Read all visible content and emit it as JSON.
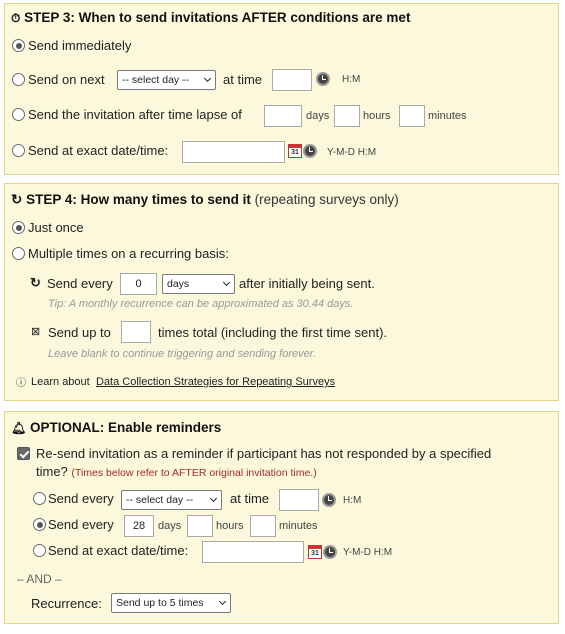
{
  "step3": {
    "title": "STEP 3: When to send invitations AFTER conditions are met",
    "send_immediately": "Send immediately",
    "send_next": "Send on next",
    "select_day": "-- select day --",
    "at_time": "at time",
    "hm": "H:M",
    "lapse": "Send the invitation after time lapse of",
    "days": "days",
    "hours": "hours",
    "minutes": "minutes",
    "exact": "Send at exact date/time:",
    "ymdhm": "Y-M-D H:M",
    "cal_num": "31"
  },
  "step4": {
    "title": "STEP 4: How many times to send it",
    "title_note": "(repeating surveys only)",
    "just_once": "Just once",
    "multiple": "Multiple times on a recurring basis:",
    "send_every": "Send every",
    "every_value": "0",
    "unit": "days",
    "after": "after initially being sent.",
    "tip1": "Tip: A monthly recurrence can be approximated as 30.44 days.",
    "send_up_to": "Send up to",
    "times_total": "times total (including the first time sent).",
    "tip2": "Leave blank to continue triggering and sending forever.",
    "learn": "Learn about",
    "link": "Data Collection Strategies for Repeating Surveys"
  },
  "reminders": {
    "title": "OPTIONAL: Enable reminders",
    "resend_line1": "Re-send invitation as a reminder if participant has not responded by a specified",
    "resend_line2": "time?",
    "resend_note": "(Times below refer to AFTER original invitation time.)",
    "send_every": "Send every",
    "select_day": "-- select day --",
    "at_time": "at time",
    "hm": "H:M",
    "days_value": "28",
    "days": "days",
    "hours": "hours",
    "minutes": "minutes",
    "exact": "Send at exact date/time:",
    "ymdhm": "Y-M-D H:M",
    "and": "– AND –",
    "recurrence": "Recurrence:",
    "recurrence_value": "Send up to 5 times"
  }
}
